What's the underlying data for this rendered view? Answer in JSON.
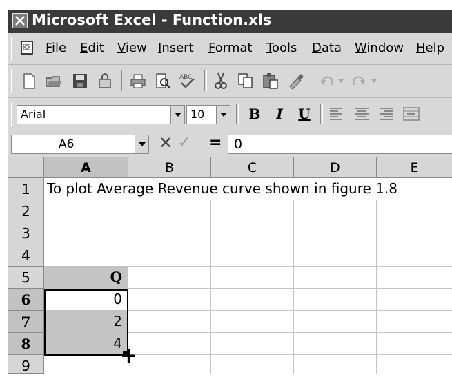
{
  "window": {
    "title": "Microsoft Excel - Function.xls",
    "icon": "excel-app-icon"
  },
  "menu": [
    "File",
    "Edit",
    "View",
    "Insert",
    "Format",
    "Tools",
    "Data",
    "Window",
    "Help"
  ],
  "format_toolbar": {
    "font": "Arial",
    "size": "10",
    "bold": "B",
    "italic": "I",
    "underline": "U"
  },
  "formula_bar": {
    "name_box": "A6",
    "equals": "=",
    "value": "0"
  },
  "sheet": {
    "columns": [
      "A",
      "B",
      "C",
      "D",
      "E"
    ],
    "selected_column": "A",
    "rows": [
      "1",
      "2",
      "3",
      "4",
      "5",
      "6",
      "7",
      "8",
      "9"
    ],
    "selected_rows": [
      "6",
      "7",
      "8"
    ],
    "cells": {
      "A1": "To plot Average Revenue curve shown in figure 1.8",
      "A5": "Q",
      "A6": "0",
      "A7": "2",
      "A8": "4"
    }
  },
  "colors": {
    "title_bar": "#3a3a3a",
    "toolbar": "#d8d8d8",
    "selection": "#c4c4c4"
  }
}
